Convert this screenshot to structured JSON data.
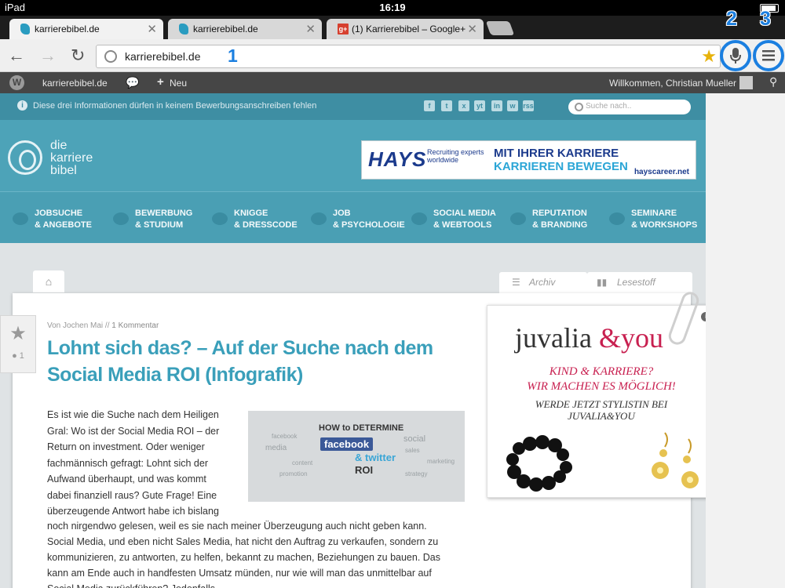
{
  "status": {
    "device": "iPad",
    "time": "16:19"
  },
  "tabs": [
    {
      "label": "karrierebibel.de"
    },
    {
      "label": "karrierebibel.de"
    },
    {
      "label": "(1) Karrierebibel – Google+"
    }
  ],
  "toolbar": {
    "url": "karrierebibel.de"
  },
  "annotations": [
    "1",
    "2",
    "3"
  ],
  "wpbar": {
    "site": "karrierebibel.de",
    "new": "Neu",
    "welcome": "Willkommen, Christian Mueller"
  },
  "site": {
    "notice": "Diese drei Informationen dürfen in keinem Bewerbungsanschreiben fehlen",
    "search_placeholder": "Suche nach..",
    "social": [
      "f",
      "t",
      "x",
      "yt",
      "in",
      "w",
      "rss"
    ],
    "logo": [
      "die",
      "karriere",
      "bibel"
    ],
    "banner": {
      "brand": "HAYS",
      "tag1": "Recruiting experts",
      "tag2": "worldwide",
      "line1": "MIT IHRER KARRIERE",
      "line2": "KARRIEREN BEWEGEN",
      "url": "hayscareer.net"
    },
    "menu": [
      {
        "l1": "JOBSUCHE",
        "l2": "& ANGEBOTE"
      },
      {
        "l1": "BEWERBUNG",
        "l2": "& STUDIUM"
      },
      {
        "l1": "KNIGGE",
        "l2": "& DRESSCODE"
      },
      {
        "l1": "JOB",
        "l2": "& PSYCHOLOGIE"
      },
      {
        "l1": "SOCIAL MEDIA",
        "l2": "& WEBTOOLS"
      },
      {
        "l1": "REPUTATION",
        "l2": "& BRANDING"
      },
      {
        "l1": "SEMINARE",
        "l2": "& WORKSHOPS"
      }
    ],
    "side_tabs": {
      "archiv": "Archiv",
      "lesestoff": "Lesestoff"
    }
  },
  "article": {
    "author_prefix": "Von Jochen Mai // ",
    "comments": "1 Kommentar",
    "comment_count": "1",
    "title": "Lohnt sich das? – Auf der Suche nach dem Social Media ROI (Infografik)",
    "para_lines": [
      "Es ist wie die Suche nach dem Heiligen",
      "Gral: Wo ist der Social Media ROI – der",
      "Return on investment. Oder weniger",
      "fachmännisch gefragt: Lohnt sich der",
      "Aufwand überhaupt, und was kommt",
      "dabei finanziell raus? Gute Frage! Eine",
      "überzeugende Antwort habe ich bislang"
    ],
    "rest_lines": [
      "noch nirgendwo gelesen, weil es sie nach meiner Überzeugung auch nicht geben kann.",
      "Social Media, und eben nicht Sales Media, hat nicht den Auftrag zu verkaufen, sondern zu",
      "kommunizieren, zu antworten, zu helfen, bekannt zu machen, Beziehungen zu bauen. Das",
      "kann am Ende auch in handfesten Umsatz münden, nur wie will man das unmittelbar auf",
      "Social Media zurückführen? Jedenfalls"
    ],
    "infographic": {
      "how": "HOW to DETERMINE",
      "fb": "facebook",
      "tw": "& twitter",
      "roi": "ROI",
      "words": [
        "facebook",
        "social",
        "media",
        "sales",
        "marketing",
        "content",
        "strategy",
        "promotion"
      ]
    }
  },
  "ad": {
    "brand1": "juvalia",
    "brand2": "&you",
    "l1": "KIND & KARRIERE?",
    "l2": "WIR MACHEN ES MÖGLICH!",
    "l3": "WERDE JETZT STYLISTIN BEI",
    "l4": "JUVALIA&YOU"
  }
}
